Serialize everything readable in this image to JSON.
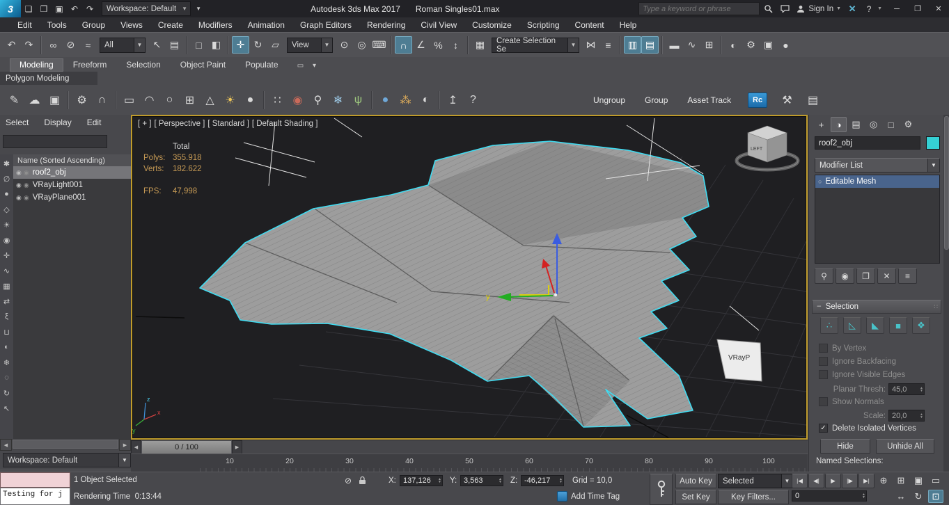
{
  "titlebar": {
    "logo_text": "3",
    "quick_icons": [
      {
        "n": "new-file-icon",
        "g": "❏"
      },
      {
        "n": "open-file-icon",
        "g": "❒"
      },
      {
        "n": "save-file-icon",
        "g": "▣"
      },
      {
        "n": "undo-quick-icon",
        "g": "↶"
      },
      {
        "n": "redo-quick-icon",
        "g": "↷"
      }
    ],
    "workspace_label": "Workspace: Default",
    "app_title": "Autodesk 3ds Max 2017",
    "doc_title": "Roman Singles01.max",
    "search_placeholder": "Type a keyword or phrase",
    "sign_in_label": "Sign In",
    "other_icons": [
      "keyword-search-icon",
      "communication-icon",
      "sign-in-person-icon",
      "a360-x-icon",
      "help-icon"
    ],
    "window_icons": [
      {
        "n": "minimize-button",
        "g": "─"
      },
      {
        "n": "maximize-button",
        "g": "❐"
      },
      {
        "n": "close-button",
        "g": "✕"
      }
    ]
  },
  "menubar": {
    "items": [
      "Edit",
      "Tools",
      "Group",
      "Views",
      "Create",
      "Modifiers",
      "Animation",
      "Graph Editors",
      "Rendering",
      "Civil View",
      "Customize",
      "Scripting",
      "Content",
      "Help"
    ]
  },
  "toolbar": {
    "filter_label": "All",
    "coord_label": "View",
    "selection_set_label": "Create Selection Se",
    "seg_history": [
      {
        "n": "undo-icon",
        "g": "↶"
      },
      {
        "n": "redo-icon",
        "g": "↷"
      }
    ],
    "seg_link": [
      {
        "n": "select-and-link-icon",
        "g": "∞"
      },
      {
        "n": "unlink-selection-icon",
        "g": "⊘"
      },
      {
        "n": "bind-to-space-warp-icon",
        "g": "≈"
      }
    ],
    "seg_select": [
      {
        "n": "select-object-icon",
        "g": "↖"
      },
      {
        "n": "select-by-name-icon",
        "g": "▤"
      }
    ],
    "seg_region": [
      {
        "n": "rectangular-selection-region-icon",
        "g": "□"
      },
      {
        "n": "window-crossing-icon",
        "g": "◧"
      }
    ],
    "seg_transform": [
      {
        "n": "select-and-move-icon",
        "g": "✛",
        "active": true
      },
      {
        "n": "select-and-rotate-icon",
        "g": "↻"
      },
      {
        "n": "select-and-scale-icon",
        "g": "▱"
      }
    ],
    "seg_pivot": [
      {
        "n": "use-pivot-point-center-icon",
        "g": "⊙"
      },
      {
        "n": "select-and-manipulate-icon",
        "g": "◎"
      },
      {
        "n": "keyboard-shortcut-override-icon",
        "g": "⌨"
      }
    ],
    "seg_snap": [
      {
        "n": "snaps-toggle-icon",
        "g": "∩",
        "active": true
      },
      {
        "n": "angle-snap-icon",
        "g": "∠"
      },
      {
        "n": "percent-snap-icon",
        "g": "%"
      },
      {
        "n": "spinner-snap-icon",
        "g": "↕"
      }
    ],
    "seg_sets": [
      {
        "n": "edit-named-selection-sets-icon",
        "g": "▦"
      }
    ],
    "seg_mirror": [
      {
        "n": "mirror-icon",
        "g": "⋈"
      },
      {
        "n": "align-icon",
        "g": "≡"
      }
    ],
    "seg_explorers": [
      {
        "n": "toggle-scene-explorer-icon",
        "g": "▥",
        "active": true
      },
      {
        "n": "toggle-layer-explorer-icon",
        "g": "▤",
        "active": true
      }
    ],
    "seg_editors": [
      {
        "n": "toggle-ribbon-icon",
        "g": "▬"
      },
      {
        "n": "curve-editor-icon",
        "g": "∿"
      },
      {
        "n": "schematic-view-icon",
        "g": "⊞"
      }
    ],
    "seg_render": [
      {
        "n": "material-editor-icon",
        "g": "◐"
      },
      {
        "n": "render-setup-icon",
        "g": "⚙"
      },
      {
        "n": "rendered-frame-window-icon",
        "g": "▣"
      },
      {
        "n": "render-production-icon",
        "g": "●"
      }
    ]
  },
  "ribbon": {
    "tabs": [
      {
        "label": "Modeling",
        "active": true
      },
      {
        "label": "Freeform"
      },
      {
        "label": "Selection"
      },
      {
        "label": "Object Paint"
      },
      {
        "label": "Populate"
      }
    ],
    "extra_icons": [
      {
        "n": "ribbon-display-toggle-icon",
        "g": "▭"
      },
      {
        "n": "ribbon-chevron-icon",
        "g": "▾"
      }
    ],
    "panel_label": "Polygon Modeling"
  },
  "tool_row": {
    "icons": [
      {
        "n": "pencil-icon",
        "g": "✎"
      },
      {
        "n": "cloud-icon",
        "g": "☁"
      },
      {
        "n": "image-icon",
        "g": "▣"
      },
      {
        "sep": true
      },
      {
        "n": "gear-icon",
        "g": "⚙"
      },
      {
        "n": "magnet-icon",
        "g": "∩"
      },
      {
        "sep": true
      },
      {
        "n": "plane-primitive-icon",
        "g": "▭"
      },
      {
        "n": "dome-primitive-icon",
        "g": "◠"
      },
      {
        "n": "circle-primitive-icon",
        "g": "○"
      },
      {
        "n": "grid-primitive-icon",
        "g": "⊞"
      },
      {
        "n": "cone-primitive-icon",
        "g": "△"
      },
      {
        "n": "sun-light-icon",
        "g": "☀",
        "c": "#e8c25a"
      },
      {
        "n": "sphere-primitive-icon",
        "g": "●"
      },
      {
        "sep": true
      },
      {
        "n": "scatter-dots-icon",
        "g": "∷"
      },
      {
        "n": "vray-sphere-icon",
        "g": "◉",
        "c": "#c96a5a"
      },
      {
        "n": "pin-icon",
        "g": "⚲"
      },
      {
        "n": "snowflake-icon",
        "g": "❄",
        "c": "#9ecbe8"
      },
      {
        "n": "foliage-icon",
        "g": "ψ",
        "c": "#9ec87e"
      },
      {
        "sep": true
      },
      {
        "n": "blue-sphere-icon",
        "g": "●",
        "c": "#6fa8d8"
      },
      {
        "n": "color-dots-icon",
        "g": "⁂",
        "c": "#d8a85a"
      },
      {
        "n": "material-ball-icon",
        "g": "◐"
      },
      {
        "sep": true
      },
      {
        "n": "export-icon",
        "g": "↥"
      },
      {
        "n": "help-circle-icon",
        "g": "?"
      }
    ],
    "buttons": [
      {
        "label": "Ungroup",
        "n": "ungroup-button"
      },
      {
        "label": "Group",
        "n": "group-button"
      },
      {
        "label": "Asset Track",
        "n": "asset-track-button"
      }
    ],
    "rc_label": "Rc",
    "end_icons": [
      {
        "n": "wrench-icon",
        "g": "⚒"
      },
      {
        "n": "list-icon",
        "g": "▤"
      }
    ]
  },
  "scene_explorer": {
    "menus": [
      "Select",
      "Display",
      "Edit"
    ],
    "header": "Name (Sorted Ascending)",
    "strip_icons": [
      {
        "n": "display-all-icon",
        "g": "✱"
      },
      {
        "n": "display-none-icon",
        "g": "∅"
      },
      {
        "n": "display-geometry-icon",
        "g": "●"
      },
      {
        "n": "display-shapes-icon",
        "g": "◇"
      },
      {
        "n": "display-lights-icon",
        "g": "☀"
      },
      {
        "n": "display-cameras-icon",
        "g": "◉"
      },
      {
        "n": "display-helpers-icon",
        "g": "✛"
      },
      {
        "n": "display-space-warps-icon",
        "g": "∿"
      },
      {
        "n": "display-groups-icon",
        "g": "▦"
      },
      {
        "n": "display-xrefs-icon",
        "g": "⇄"
      },
      {
        "n": "display-bones-icon",
        "g": "ξ"
      },
      {
        "n": "display-containers-icon",
        "g": "⊔"
      },
      {
        "n": "display-materials-icon",
        "g": "◐"
      },
      {
        "n": "display-frozen-icon",
        "g": "❄"
      },
      {
        "n": "display-hidden-icon",
        "g": "◌"
      },
      {
        "n": "sync-selection-icon",
        "g": "↻"
      },
      {
        "n": "pick-parent-icon",
        "g": "↖"
      }
    ],
    "rows": [
      {
        "label": "roof2_obj",
        "selected": true
      },
      {
        "label": "VRayLight001"
      },
      {
        "label": "VRayPlane001"
      }
    ],
    "workspace_label": "Workspace: Default"
  },
  "viewport": {
    "label_segments": [
      "[ + ]",
      "[ Perspective ]",
      "[ Standard ]",
      "[ Default Shading ]"
    ],
    "stats": {
      "total": "Total",
      "polys_label": "Polys:",
      "polys": "355.918",
      "verts_label": "Verts:",
      "verts": "182.622",
      "fps_label": "FPS:",
      "fps": "47,998"
    },
    "gizmo_axis": "y",
    "axis": {
      "x": "x",
      "y": "y",
      "z": "z"
    },
    "viewcube_face": "LEFT",
    "vray_plane_label": "VRayP"
  },
  "command_panel": {
    "tabs": [
      {
        "n": "create-tab-icon",
        "g": "+"
      },
      {
        "n": "modify-tab-icon",
        "g": "◑",
        "active": true
      },
      {
        "n": "hierarchy-tab-icon",
        "g": "▤"
      },
      {
        "n": "motion-tab-icon",
        "g": "◎"
      },
      {
        "n": "display-tab-icon",
        "g": "□"
      },
      {
        "n": "utilities-tab-icon",
        "g": "⚙"
      }
    ],
    "object_name": "roof2_obj",
    "modifier_list_label": "Modifier List",
    "stack_rows": [
      {
        "label": "Editable Mesh",
        "selected": true
      }
    ],
    "stack_buttons": [
      {
        "n": "pin-stack-icon",
        "g": "⚲"
      },
      {
        "n": "show-end-result-icon",
        "g": "◉"
      },
      {
        "n": "make-unique-icon",
        "g": "❐"
      },
      {
        "n": "remove-modifier-icon",
        "g": "✕"
      },
      {
        "n": "configure-modifier-sets-icon",
        "g": "≡"
      }
    ],
    "rollout_title": "Selection",
    "subobject_icons": [
      {
        "n": "vertex-icon",
        "g": "∴"
      },
      {
        "n": "edge-icon",
        "g": "◺"
      },
      {
        "n": "face-icon",
        "g": "◣"
      },
      {
        "n": "polygon-icon",
        "g": "■"
      },
      {
        "n": "element-icon",
        "g": "❖"
      }
    ],
    "checkboxes": [
      {
        "label": "By Vertex",
        "checked": false,
        "enabled": false
      },
      {
        "label": "Ignore Backfacing",
        "checked": false,
        "enabled": false
      },
      {
        "label": "Ignore Visible Edges",
        "checked": false,
        "enabled": false
      }
    ],
    "planar_label": "Planar Thresh:",
    "planar_value": "45,0",
    "show_normals": {
      "label": "Show Normals",
      "checked": false,
      "enabled": false
    },
    "scale_label": "Scale:",
    "scale_value": "20,0",
    "delete_isolated": {
      "label": "Delete Isolated Vertices",
      "checked": true,
      "enabled": true
    },
    "hide_label": "Hide",
    "unhide_label": "Unhide All",
    "named_selections_label": "Named Selections:"
  },
  "timeline": {
    "slider_value": "0 / 100",
    "ticks": [
      "10",
      "20",
      "30",
      "40",
      "50",
      "60",
      "70",
      "80",
      "90",
      "100"
    ]
  },
  "statusbar": {
    "listener_text": "Testing for j",
    "selection_status": "1 Object Selected",
    "prompt": "Rendering Time  0:13:44",
    "x_label": "X:",
    "x_value": "137,126",
    "y_label": "Y:",
    "y_value": "3,563",
    "z_label": "Z:",
    "z_value": "-46,217",
    "grid_label": "Grid = 10,0",
    "add_time_tag": "Add Time Tag",
    "auto_key_label": "Auto Key",
    "set_key_label": "Set Key",
    "selected_label": "Selected",
    "key_filters_label": "Key Filters...",
    "time_value": "0",
    "playback": [
      {
        "n": "go-to-start-icon",
        "g": "|◀"
      },
      {
        "n": "previous-frame-icon",
        "g": "◀|"
      },
      {
        "n": "play-animation-icon",
        "g": "▶"
      },
      {
        "n": "next-frame-icon",
        "g": "|▶"
      },
      {
        "n": "go-to-end-icon",
        "g": "▶|"
      }
    ],
    "nav_row1": [
      {
        "n": "zoom-icon",
        "g": "⊕"
      },
      {
        "n": "zoom-all-icon",
        "g": "⊞"
      },
      {
        "n": "zoom-extents-icon",
        "g": "▣"
      },
      {
        "n": "zoom-region-icon",
        "g": "▭"
      }
    ],
    "nav_row2": [
      {
        "n": "pan-view-icon",
        "g": "↔"
      },
      {
        "n": "orbit-icon",
        "g": "↻"
      },
      {
        "n": "maximize-viewport-icon",
        "g": "⊡",
        "active": true
      }
    ]
  }
}
